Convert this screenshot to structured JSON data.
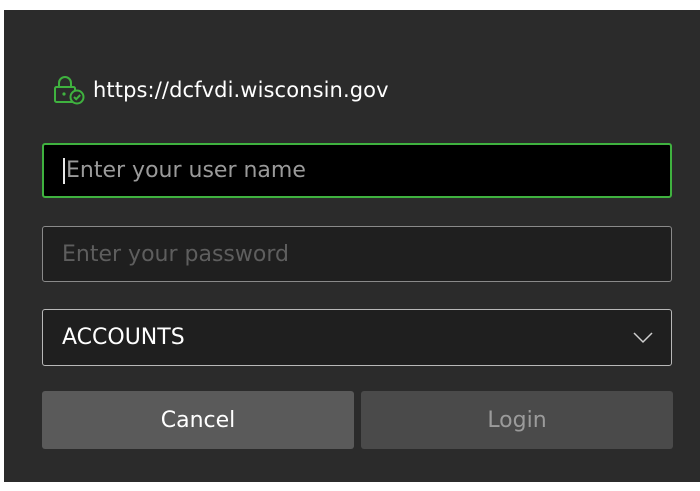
{
  "dialog": {
    "url": "https://dcfvdi.wisconsin.gov",
    "lock_icon": "lock-check-icon",
    "username": {
      "placeholder": "Enter your user name",
      "value": ""
    },
    "password": {
      "placeholder": "Enter your password",
      "value": ""
    },
    "domain_select": {
      "selected": "ACCOUNTS"
    },
    "buttons": {
      "cancel": "Cancel",
      "login": "Login"
    }
  },
  "colors": {
    "background": "#2b2b2b",
    "focus_border": "#3fb23f",
    "accent_icon": "#3fb23f"
  }
}
